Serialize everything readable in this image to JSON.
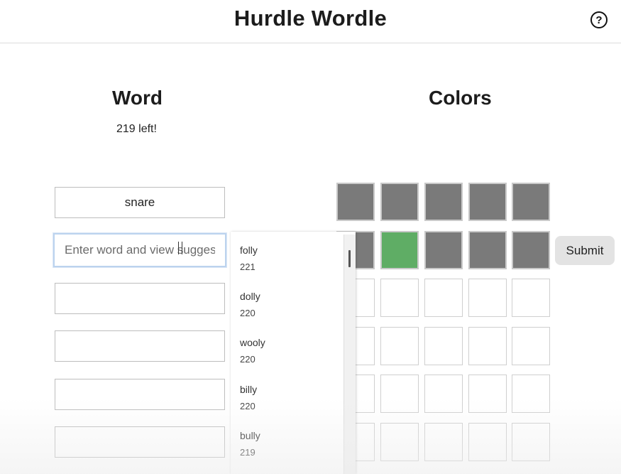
{
  "header": {
    "title": "Hurdle Wordle",
    "help_icon": "question-circle-icon",
    "help_glyph": "?"
  },
  "word_panel": {
    "heading": "Word",
    "remaining": "219 left!",
    "entered_words": [
      "snare",
      "",
      "",
      "",
      ""
    ],
    "input": {
      "value": "",
      "placeholder": "Enter word and view suggestions"
    }
  },
  "suggestions": [
    {
      "word": "folly",
      "count": "221"
    },
    {
      "word": "dolly",
      "count": "220"
    },
    {
      "word": "wooly",
      "count": "220"
    },
    {
      "word": "billy",
      "count": "220"
    },
    {
      "word": "bully",
      "count": "219"
    }
  ],
  "colors_panel": {
    "heading": "Colors",
    "palette": {
      "gray": "#7a7a7a",
      "green": "#5fad65",
      "empty": "#ffffff"
    },
    "rows": [
      [
        "gray",
        "gray",
        "gray",
        "gray",
        "gray"
      ],
      [
        "gray",
        "green",
        "gray",
        "gray",
        "gray"
      ],
      [
        "empty",
        "empty",
        "empty",
        "empty",
        "empty"
      ],
      [
        "empty",
        "empty",
        "empty",
        "empty",
        "empty"
      ],
      [
        "empty",
        "empty",
        "empty",
        "empty",
        "empty"
      ],
      [
        "empty",
        "empty",
        "empty",
        "empty",
        "empty"
      ]
    ],
    "submit_label": "Submit"
  }
}
